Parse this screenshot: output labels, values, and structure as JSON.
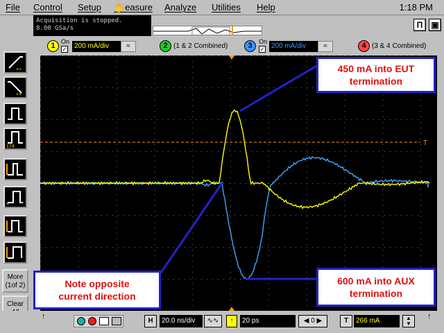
{
  "menu": {
    "file": "File",
    "control": "Control",
    "setup": "Setup",
    "measure": "Measure",
    "analyze": "Analyze",
    "utilities": "Utilities",
    "help": "Help",
    "clock": "1:18 PM"
  },
  "status": {
    "line1": "Acquisition is stopped.",
    "line2": "8.00 GSa/s"
  },
  "channels": {
    "ch1": {
      "number": "1",
      "on_label": "On",
      "scale": "200 mA/div",
      "color": "#ffff00"
    },
    "ch2": {
      "number": "2",
      "text": "(1 & 2 Combined)",
      "color": "#22cc22"
    },
    "ch3": {
      "number": "3",
      "on_label": "On",
      "scale": "200 mA/div",
      "color": "#3399ff"
    },
    "ch4": {
      "number": "4",
      "text": "(3 & 4 Combined)",
      "color": "#ff4444"
    }
  },
  "left_buttons": {
    "more_line1": "More",
    "more_line2": "(1of 2)",
    "clear_line1": "Clear",
    "clear_line2": "All"
  },
  "screen": {
    "trigger_marker": "T",
    "ground_marker": "T"
  },
  "callouts": {
    "eut_line1": "450 mA into EUT",
    "eut_line2": "termination",
    "aux_line1": "600 mA into AUX",
    "aux_line2": "termination",
    "note_line1": "Note opposite",
    "note_line2": "current direction"
  },
  "bottom": {
    "h_label": "H",
    "timebase": "20.0 ns/div",
    "delay": "20 ps",
    "trigger_level": "266 mA",
    "t_label": "T"
  },
  "colors": {
    "ch1_trace": "#ffff00",
    "ch3_trace": "#40a8ff",
    "grid": "#606060",
    "callout_border": "#2222cc",
    "callout_text": "#e01010",
    "trigger_line": "#ff9900"
  }
}
